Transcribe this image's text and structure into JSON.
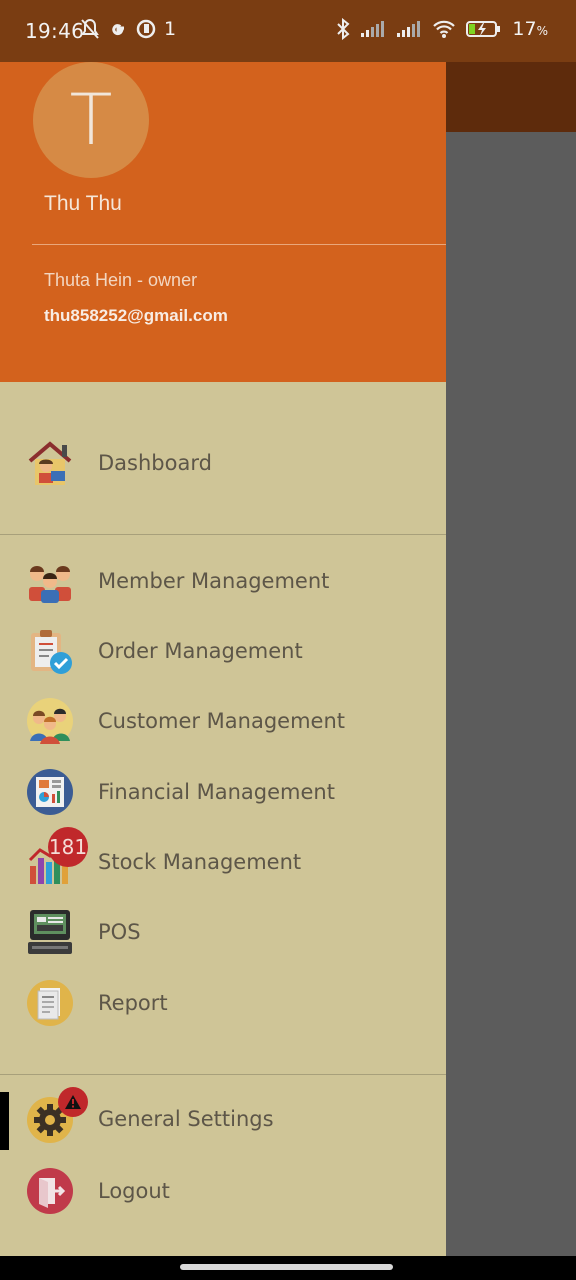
{
  "status_bar": {
    "time": "19:46",
    "sim_indicator": "1",
    "battery_value": "17",
    "battery_unit": "%",
    "icons": [
      "mute-bell-icon",
      "google-icon",
      "data-saver-icon",
      "bluetooth-icon",
      "signal-icon",
      "signal-icon",
      "wifi-icon",
      "battery-charging-icon"
    ]
  },
  "drawer": {
    "avatar_letter": "T",
    "user_name": "Thu Thu",
    "company_line": "Thuta Hein - owner",
    "email": "thu858252@gmail.com",
    "colors": {
      "header": "#d3621d",
      "body": "#cfc597",
      "badge": "#c0282b"
    },
    "menu": {
      "dashboard": "Dashboard",
      "member": "Member Management",
      "order": "Order Management",
      "customer": "Customer Management",
      "financial": "Financial Management",
      "stock": "Stock Management",
      "stock_badge": "181",
      "pos": "POS",
      "report": "Report",
      "settings": "General Settings",
      "logout": "Logout"
    }
  }
}
